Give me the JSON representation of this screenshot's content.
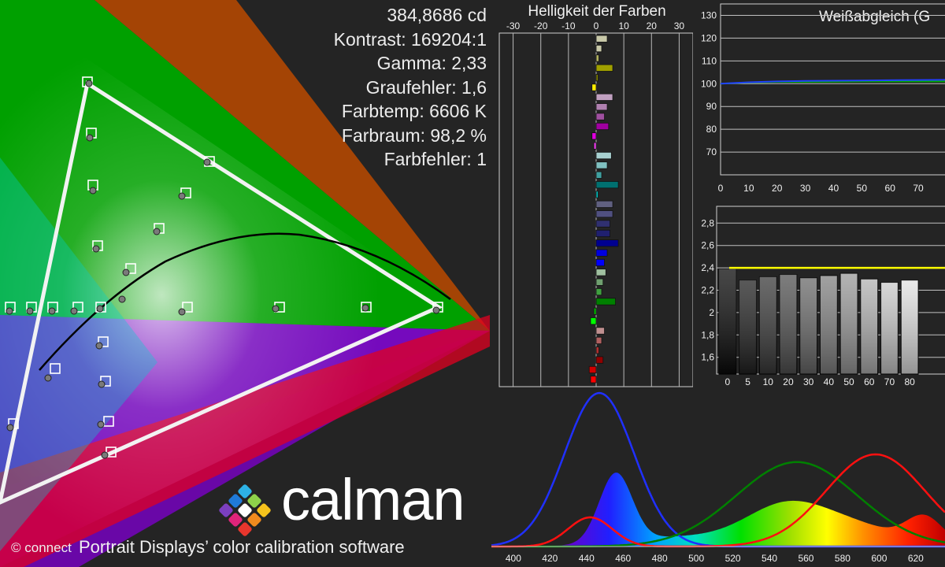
{
  "stats": {
    "luminance": "384,8686 cd",
    "contrast": "Kontrast: 169204:1",
    "gamma": "Gamma: 2,33",
    "gray_error": "Graufehler: 1,6",
    "color_temp": "Farbtemp: 6606 K",
    "gamut": "Farbraum: 98,2 %",
    "color_error": "Farbfehler: 1"
  },
  "branding": {
    "logo_text": "calman",
    "tagline": "Portrait Displays’ color calibration software",
    "copyright": "© connect"
  },
  "colors": {
    "background": "#242424",
    "gamma_target": "#ffff00",
    "wb_red": "#00aa00",
    "wb_blue": "#2040ff"
  },
  "chart_data": [
    {
      "type": "bar",
      "title": "Helligkeit der Farben",
      "orientation": "horizontal",
      "x_ticks": [
        "-30",
        "-20",
        "-10",
        "0",
        "10",
        "20",
        "30"
      ],
      "xlim": [
        -35,
        35
      ],
      "bars": [
        {
          "value": 4,
          "color": "#c8c8a8"
        },
        {
          "value": 2,
          "color": "#c8c8a8"
        },
        {
          "value": 1,
          "color": "#b0b060"
        },
        {
          "value": 6,
          "color": "#a0a000"
        },
        {
          "value": 0,
          "color": "#808000"
        },
        {
          "value": -1.5,
          "color": "#ffee00"
        },
        {
          "value": 6,
          "color": "#c0a0c0"
        },
        {
          "value": 4,
          "color": "#b080b0"
        },
        {
          "value": 3,
          "color": "#a050a0"
        },
        {
          "value": 4.5,
          "color": "#a000a0"
        },
        {
          "value": -1.5,
          "color": "#e000e0"
        },
        {
          "value": -0.8,
          "color": "#ff40ff"
        },
        {
          "value": 5.5,
          "color": "#a8d0d0"
        },
        {
          "value": 4,
          "color": "#80c0c0"
        },
        {
          "value": 2,
          "color": "#40a0a0"
        },
        {
          "value": 8,
          "color": "#007070"
        },
        {
          "value": 0,
          "color": "#00c0c0"
        },
        {
          "value": 6,
          "color": "#606080"
        },
        {
          "value": 6,
          "color": "#505080"
        },
        {
          "value": 5,
          "color": "#303070"
        },
        {
          "value": 5,
          "color": "#202070"
        },
        {
          "value": 8,
          "color": "#000090"
        },
        {
          "value": 4,
          "color": "#0000e0"
        },
        {
          "value": 3,
          "color": "#0000ff"
        },
        {
          "value": 3.5,
          "color": "#a0c0a0"
        },
        {
          "value": 2.5,
          "color": "#70a070"
        },
        {
          "value": 2,
          "color": "#40a040"
        },
        {
          "value": 7,
          "color": "#008000"
        },
        {
          "value": -0.8,
          "color": "#00c000"
        },
        {
          "value": -2,
          "color": "#00ff00"
        },
        {
          "value": 3,
          "color": "#c09090"
        },
        {
          "value": 2,
          "color": "#b06060"
        },
        {
          "value": 1,
          "color": "#b03030"
        },
        {
          "value": 2.5,
          "color": "#900000"
        },
        {
          "value": -2.5,
          "color": "#d00000"
        },
        {
          "value": -2,
          "color": "#ff0000"
        }
      ]
    },
    {
      "type": "line",
      "title": "Weißabgleich (G",
      "x_ticks": [
        "0",
        "10",
        "20",
        "30",
        "40",
        "50",
        "60",
        "70"
      ],
      "y_ticks": [
        "70",
        "80",
        "90",
        "100",
        "110",
        "120",
        "130"
      ],
      "xlim": [
        0,
        75
      ],
      "ylim": [
        60,
        135
      ],
      "series": [
        {
          "color": "#00aa00",
          "x": [
            0,
            10,
            20,
            30,
            40,
            50,
            60,
            70,
            80
          ],
          "values": [
            100,
            100.5,
            100.8,
            100.8,
            100.9,
            101.0,
            101.0,
            101.0,
            101.0
          ]
        },
        {
          "color": "#2040ff",
          "x": [
            0,
            10,
            20,
            30,
            40,
            50,
            60,
            70,
            80
          ],
          "values": [
            100,
            100.6,
            101.0,
            101.2,
            101.3,
            101.4,
            101.5,
            101.6,
            101.7
          ]
        }
      ]
    },
    {
      "type": "bar",
      "title": "",
      "categories": [
        "0",
        "5",
        "10",
        "20",
        "30",
        "40",
        "50",
        "60",
        "70",
        "80"
      ],
      "values": [
        2.39,
        2.29,
        2.32,
        2.34,
        2.31,
        2.33,
        2.35,
        2.3,
        2.27,
        2.29
      ],
      "y_ticks": [
        "1,6",
        "1,8",
        "2",
        "2,2",
        "2,4",
        "2,6",
        "2,8"
      ],
      "ylim": [
        1.45,
        2.95
      ],
      "target": 2.4
    },
    {
      "type": "line",
      "title": "",
      "x_ticks": [
        "400",
        "420",
        "440",
        "460",
        "480",
        "500",
        "520",
        "540",
        "560",
        "580",
        "600",
        "620"
      ],
      "xlim": [
        388,
        636
      ],
      "series": [
        {
          "color": "#2030ff",
          "peak_nm": 447,
          "width_nm": 19,
          "amplitude": 1.0
        },
        {
          "color": "#008000",
          "peak_nm": 555,
          "width_nm": 33,
          "amplitude": 0.55
        },
        {
          "color": "#ff1010",
          "peak_nm": 598,
          "width_nm": 27,
          "amplitude": 0.6
        }
      ]
    }
  ]
}
